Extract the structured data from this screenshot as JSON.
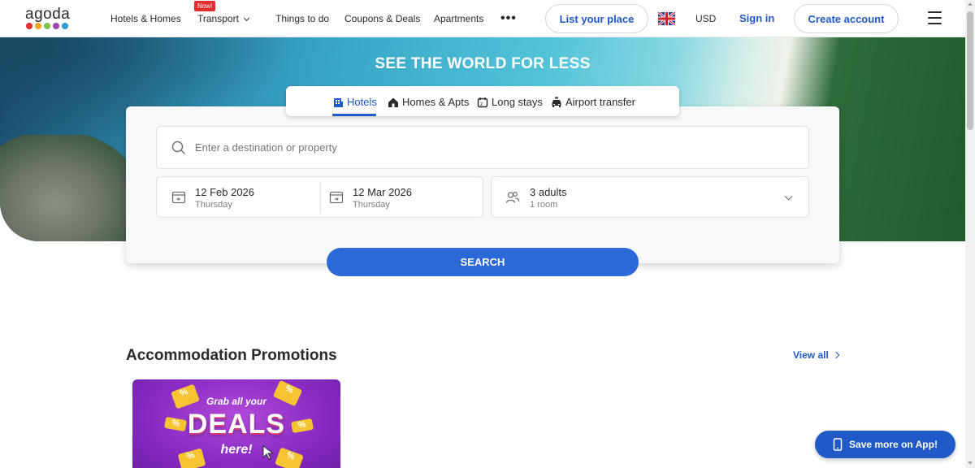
{
  "header": {
    "logo_text": "agoda",
    "logo_dot_colors": [
      "#e12d2d",
      "#f2a31b",
      "#7cc144",
      "#a23fb8",
      "#2e9ad6"
    ],
    "nav": {
      "hotels_homes": "Hotels & Homes",
      "transport": "Transport",
      "transport_badge": "Now!",
      "things_to_do": "Things to do",
      "coupons_deals": "Coupons & Deals",
      "apartments": "Apartments",
      "more": "•••"
    },
    "list_your_place": "List your place",
    "flag_icon": "uk-flag-icon",
    "currency": "USD",
    "sign_in": "Sign in",
    "create_account": "Create account",
    "menu_icon": "hamburger-menu-icon"
  },
  "hero": {
    "title": "SEE THE WORLD FOR LESS"
  },
  "tabs": [
    {
      "label": "Hotels",
      "icon": "hotel-icon",
      "active": true
    },
    {
      "label": "Homes & Apts",
      "icon": "home-icon",
      "active": false
    },
    {
      "label": "Long stays",
      "icon": "calendar-icon",
      "active": false
    },
    {
      "label": "Airport transfer",
      "icon": "car-icon",
      "active": false
    }
  ],
  "search": {
    "destination_placeholder": "Enter a destination or property",
    "check_in": {
      "date": "12 Feb 2026",
      "day": "Thursday"
    },
    "check_out": {
      "date": "12 Mar 2026",
      "day": "Thursday"
    },
    "guests": {
      "adults": "3 adults",
      "rooms": "1 room"
    },
    "button_label": "SEARCH"
  },
  "promotions": {
    "title": "Accommodation Promotions",
    "view_all": "View all",
    "card": {
      "line1": "Grab all your",
      "line2": "DEALS",
      "line3": "here!"
    }
  },
  "app_button": "Save more on App!",
  "colors": {
    "accent": "#2059c8",
    "search_button": "#2c69d8",
    "badge": "#e12d2d"
  }
}
